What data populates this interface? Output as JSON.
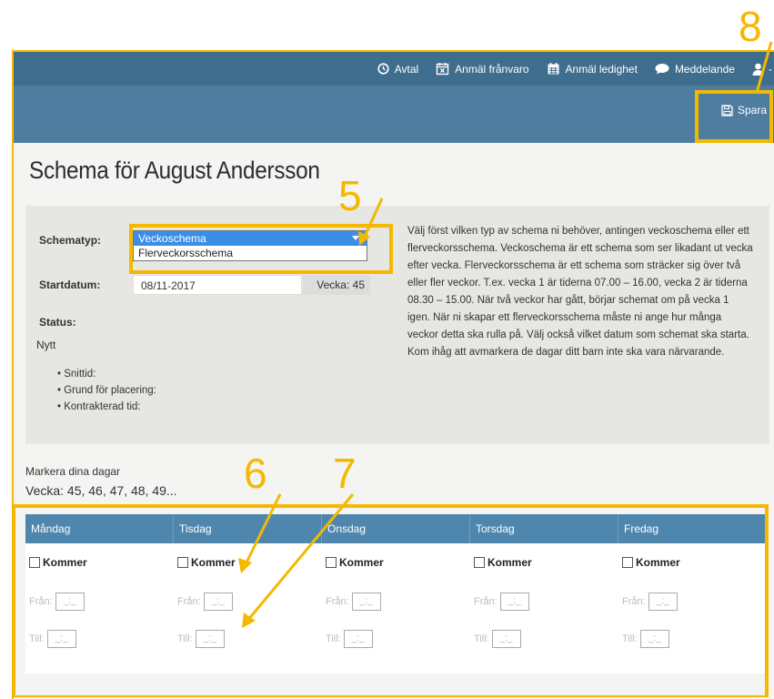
{
  "nav": {
    "avtal": "Avtal",
    "anmal_franvaro": "Anmäl frånvaro",
    "anmal_ledighet": "Anmäl ledighet",
    "meddelande": "Meddelande",
    "user_suffix": "-"
  },
  "toolbar": {
    "save_label": "Spara"
  },
  "page": {
    "title": "Schema för August Andersson"
  },
  "form": {
    "schematyp_label": "Schematyp:",
    "schematyp_options": [
      "Veckoschema",
      "Flerveckorsschema"
    ],
    "schematyp_selected": "Veckoschema",
    "startdatum_label": "Startdatum:",
    "startdatum_value": "08/11-2017",
    "vecka_value": "Vecka: 45",
    "status_label": "Status:",
    "status_value": "Nytt",
    "bullets": [
      "Snittid:",
      "Grund för placering:",
      "Kontrakterad tid:"
    ]
  },
  "info_text": "Välj först vilken typ av schema ni behöver, antingen veckoschema eller ett flerveckorsschema. Veckoschema är ett schema som ser likadant ut vecka efter vecka. Flerveckorsschema är ett schema som sträcker sig över två eller fler veckor. T.ex. vecka 1 är tiderna 07.00 – 16.00, vecka 2 är tiderna 08.30 – 15.00. När två veckor har gått, börjar schemat om på vecka 1 igen. När ni skapar ett flerveckorsschema måste ni ange hur många veckor detta ska rulla på. Välj också vilket datum som schemat ska starta. Kom ihåg att avmarkera de dagar ditt barn inte ska vara närvarande.",
  "days_section": {
    "heading": "Markera dina dagar",
    "weeks": "Vecka: 45, 46, 47, 48, 49..."
  },
  "days": [
    {
      "name": "Måndag"
    },
    {
      "name": "Tisdag"
    },
    {
      "name": "Onsdag"
    },
    {
      "name": "Torsdag"
    },
    {
      "name": "Fredag"
    }
  ],
  "day_labels": {
    "kommer": "Kommer",
    "fran": "Från:",
    "till": "Till:",
    "time_placeholder": "_:_"
  },
  "annotations": {
    "n5": "5",
    "n6": "6",
    "n7": "7",
    "n8": "8"
  },
  "colors": {
    "header": "#3f6d8d",
    "subbar": "#4f7da0",
    "table_header": "#4f86ae",
    "annotation": "#f5b800",
    "selected_option": "#3a8ee6"
  }
}
